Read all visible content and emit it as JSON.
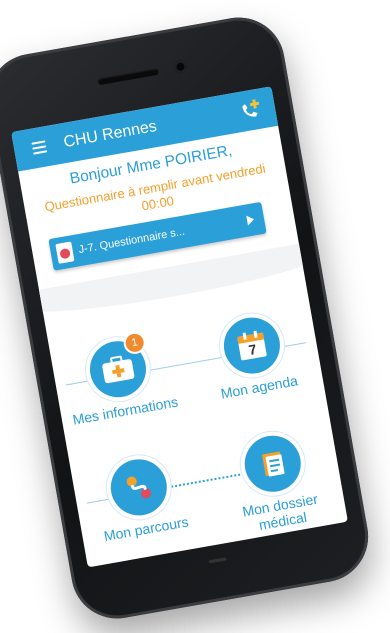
{
  "app": {
    "title": "CHU Rennes"
  },
  "greeting": "Bonjour Mme POIRIER,",
  "reminder": "Questionnaire à remplir avant vendredi 00:00",
  "questionnaire_button": {
    "label": "J-7. Questionnaire s..."
  },
  "menu": [
    {
      "label": "Mes informations",
      "icon": "medical-kit-icon",
      "badge": "1"
    },
    {
      "label": "Mon agenda",
      "icon": "calendar-icon",
      "day": "7"
    },
    {
      "label": "Mon parcours",
      "icon": "route-icon"
    },
    {
      "label": "Mon dossier médical",
      "icon": "folder-documents-icon"
    }
  ],
  "colors": {
    "primary": "#2a9fd8",
    "accent": "#f4a12c",
    "badge": "#f08a2d",
    "phone_body": "#1a1b1e"
  }
}
